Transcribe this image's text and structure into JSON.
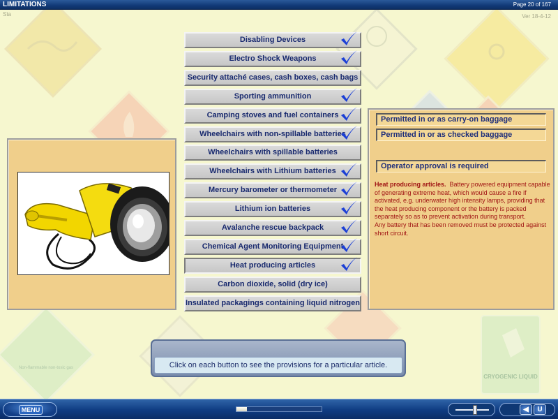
{
  "window": {
    "title": "LIMITATIONS",
    "page_indicator": "Page 20 of 167",
    "code": "Sta",
    "version": "Ver 18-4-12"
  },
  "articles": [
    {
      "label": "Disabling Devices",
      "checked": true
    },
    {
      "label": "Electro Shock Weapons",
      "checked": true
    },
    {
      "label": "Security attaché cases, cash boxes, cash bags",
      "checked": false
    },
    {
      "label": "Sporting ammunition",
      "checked": true
    },
    {
      "label": "Camping stoves and fuel containers",
      "checked": true
    },
    {
      "label": "Wheelchairs with non-spillable batteries",
      "checked": true
    },
    {
      "label": "Wheelchairs with spillable batteries",
      "checked": false
    },
    {
      "label": "Wheelchairs with Lithium batteries",
      "checked": true
    },
    {
      "label": "Mercury barometer or thermometer",
      "checked": true
    },
    {
      "label": "Lithium ion batteries",
      "checked": true
    },
    {
      "label": "Avalanche rescue backpack",
      "checked": true
    },
    {
      "label": "Chemical Agent Monitoring Equipment",
      "checked": true
    },
    {
      "label": "Heat producing articles",
      "checked": true,
      "selected": true
    },
    {
      "label": "Carbon dioxide, solid (dry ice)",
      "checked": false
    },
    {
      "label": "Insulated packagings containing liquid nitrogen",
      "checked": false
    }
  ],
  "provisions": {
    "carry_on": "Permitted in or as carry-on baggage",
    "checked": "Permitted in or as checked baggage",
    "operator": "Operator approval is required"
  },
  "description": {
    "heading": "Heat producing articles.",
    "body": "Battery powered equipment capable of generating extreme heat, which would cause a fire if activated, e.g. underwater high intensity lamps, providing that the heat producing component or the battery is packed separately so as to prevent activation during transport.",
    "note": "Any battery that has been removed must be protected against short circuit."
  },
  "instruction": "Click on each button to see the provisions for a particular article.",
  "footer": {
    "menu_label": "MENU",
    "progress_fraction": 0.12,
    "slider_position": 0.6,
    "back_icon": "◀",
    "exit_label": "U"
  },
  "background_placards": {
    "left_caption": "Non-flammable non-toxic gas",
    "right_caption": "CRYOGENIC LIQUID"
  },
  "colors": {
    "accent_blue": "#18296e",
    "check_blue": "#1b3fd6",
    "desc_red": "#a01414",
    "panel": "#f0cf8b"
  }
}
